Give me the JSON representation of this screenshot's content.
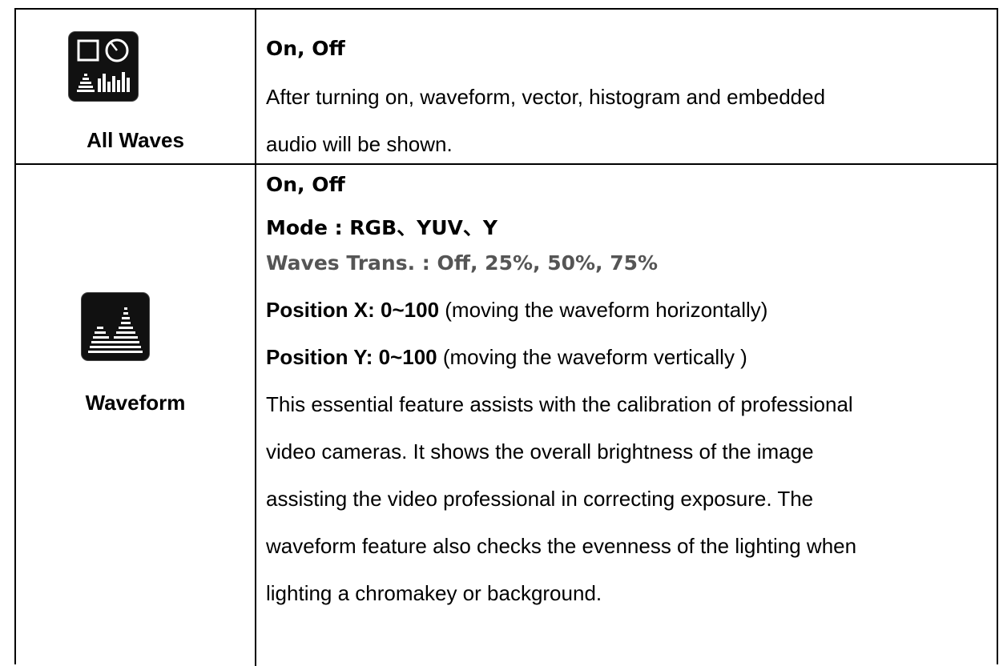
{
  "rows": [
    {
      "name": "All Waves",
      "icon": "all-waves-icon",
      "title": "On, Off",
      "lines": [
        "After turning on, waveform, vector, histogram and embedded",
        "audio will be shown."
      ]
    },
    {
      "name": "Waveform",
      "icon": "waveform-icon",
      "title": "On, Off",
      "mode": "Mode : RGB、YUV、Y",
      "trans": "Waves Trans. : Off, 25%, 50%, 75%",
      "pos_x_label": "Position X: 0~100",
      "pos_x_note": " (moving the waveform horizontally)",
      "pos_y_label": "Position Y: 0~100",
      "pos_y_note": " (moving the waveform vertically )",
      "lines": [
        "This essential feature assists with the calibration of professional",
        "video cameras. It shows the overall brightness of the image",
        "assisting the video professional in correcting exposure. The",
        "waveform feature also checks the evenness of the lighting when",
        "lighting a chromakey or background."
      ]
    }
  ]
}
